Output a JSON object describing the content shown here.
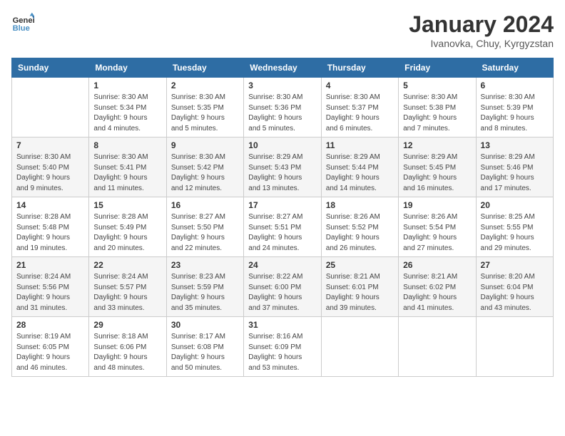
{
  "header": {
    "logo_line1": "General",
    "logo_line2": "Blue",
    "month": "January 2024",
    "location": "Ivanovka, Chuy, Kyrgyzstan"
  },
  "weekdays": [
    "Sunday",
    "Monday",
    "Tuesday",
    "Wednesday",
    "Thursday",
    "Friday",
    "Saturday"
  ],
  "weeks": [
    [
      {
        "day": "",
        "info": ""
      },
      {
        "day": "1",
        "info": "Sunrise: 8:30 AM\nSunset: 5:34 PM\nDaylight: 9 hours\nand 4 minutes."
      },
      {
        "day": "2",
        "info": "Sunrise: 8:30 AM\nSunset: 5:35 PM\nDaylight: 9 hours\nand 5 minutes."
      },
      {
        "day": "3",
        "info": "Sunrise: 8:30 AM\nSunset: 5:36 PM\nDaylight: 9 hours\nand 5 minutes."
      },
      {
        "day": "4",
        "info": "Sunrise: 8:30 AM\nSunset: 5:37 PM\nDaylight: 9 hours\nand 6 minutes."
      },
      {
        "day": "5",
        "info": "Sunrise: 8:30 AM\nSunset: 5:38 PM\nDaylight: 9 hours\nand 7 minutes."
      },
      {
        "day": "6",
        "info": "Sunrise: 8:30 AM\nSunset: 5:39 PM\nDaylight: 9 hours\nand 8 minutes."
      }
    ],
    [
      {
        "day": "7",
        "info": "Sunrise: 8:30 AM\nSunset: 5:40 PM\nDaylight: 9 hours\nand 9 minutes."
      },
      {
        "day": "8",
        "info": "Sunrise: 8:30 AM\nSunset: 5:41 PM\nDaylight: 9 hours\nand 11 minutes."
      },
      {
        "day": "9",
        "info": "Sunrise: 8:30 AM\nSunset: 5:42 PM\nDaylight: 9 hours\nand 12 minutes."
      },
      {
        "day": "10",
        "info": "Sunrise: 8:29 AM\nSunset: 5:43 PM\nDaylight: 9 hours\nand 13 minutes."
      },
      {
        "day": "11",
        "info": "Sunrise: 8:29 AM\nSunset: 5:44 PM\nDaylight: 9 hours\nand 14 minutes."
      },
      {
        "day": "12",
        "info": "Sunrise: 8:29 AM\nSunset: 5:45 PM\nDaylight: 9 hours\nand 16 minutes."
      },
      {
        "day": "13",
        "info": "Sunrise: 8:29 AM\nSunset: 5:46 PM\nDaylight: 9 hours\nand 17 minutes."
      }
    ],
    [
      {
        "day": "14",
        "info": "Sunrise: 8:28 AM\nSunset: 5:48 PM\nDaylight: 9 hours\nand 19 minutes."
      },
      {
        "day": "15",
        "info": "Sunrise: 8:28 AM\nSunset: 5:49 PM\nDaylight: 9 hours\nand 20 minutes."
      },
      {
        "day": "16",
        "info": "Sunrise: 8:27 AM\nSunset: 5:50 PM\nDaylight: 9 hours\nand 22 minutes."
      },
      {
        "day": "17",
        "info": "Sunrise: 8:27 AM\nSunset: 5:51 PM\nDaylight: 9 hours\nand 24 minutes."
      },
      {
        "day": "18",
        "info": "Sunrise: 8:26 AM\nSunset: 5:52 PM\nDaylight: 9 hours\nand 26 minutes."
      },
      {
        "day": "19",
        "info": "Sunrise: 8:26 AM\nSunset: 5:54 PM\nDaylight: 9 hours\nand 27 minutes."
      },
      {
        "day": "20",
        "info": "Sunrise: 8:25 AM\nSunset: 5:55 PM\nDaylight: 9 hours\nand 29 minutes."
      }
    ],
    [
      {
        "day": "21",
        "info": "Sunrise: 8:24 AM\nSunset: 5:56 PM\nDaylight: 9 hours\nand 31 minutes."
      },
      {
        "day": "22",
        "info": "Sunrise: 8:24 AM\nSunset: 5:57 PM\nDaylight: 9 hours\nand 33 minutes."
      },
      {
        "day": "23",
        "info": "Sunrise: 8:23 AM\nSunset: 5:59 PM\nDaylight: 9 hours\nand 35 minutes."
      },
      {
        "day": "24",
        "info": "Sunrise: 8:22 AM\nSunset: 6:00 PM\nDaylight: 9 hours\nand 37 minutes."
      },
      {
        "day": "25",
        "info": "Sunrise: 8:21 AM\nSunset: 6:01 PM\nDaylight: 9 hours\nand 39 minutes."
      },
      {
        "day": "26",
        "info": "Sunrise: 8:21 AM\nSunset: 6:02 PM\nDaylight: 9 hours\nand 41 minutes."
      },
      {
        "day": "27",
        "info": "Sunrise: 8:20 AM\nSunset: 6:04 PM\nDaylight: 9 hours\nand 43 minutes."
      }
    ],
    [
      {
        "day": "28",
        "info": "Sunrise: 8:19 AM\nSunset: 6:05 PM\nDaylight: 9 hours\nand 46 minutes."
      },
      {
        "day": "29",
        "info": "Sunrise: 8:18 AM\nSunset: 6:06 PM\nDaylight: 9 hours\nand 48 minutes."
      },
      {
        "day": "30",
        "info": "Sunrise: 8:17 AM\nSunset: 6:08 PM\nDaylight: 9 hours\nand 50 minutes."
      },
      {
        "day": "31",
        "info": "Sunrise: 8:16 AM\nSunset: 6:09 PM\nDaylight: 9 hours\nand 53 minutes."
      },
      {
        "day": "",
        "info": ""
      },
      {
        "day": "",
        "info": ""
      },
      {
        "day": "",
        "info": ""
      }
    ]
  ]
}
